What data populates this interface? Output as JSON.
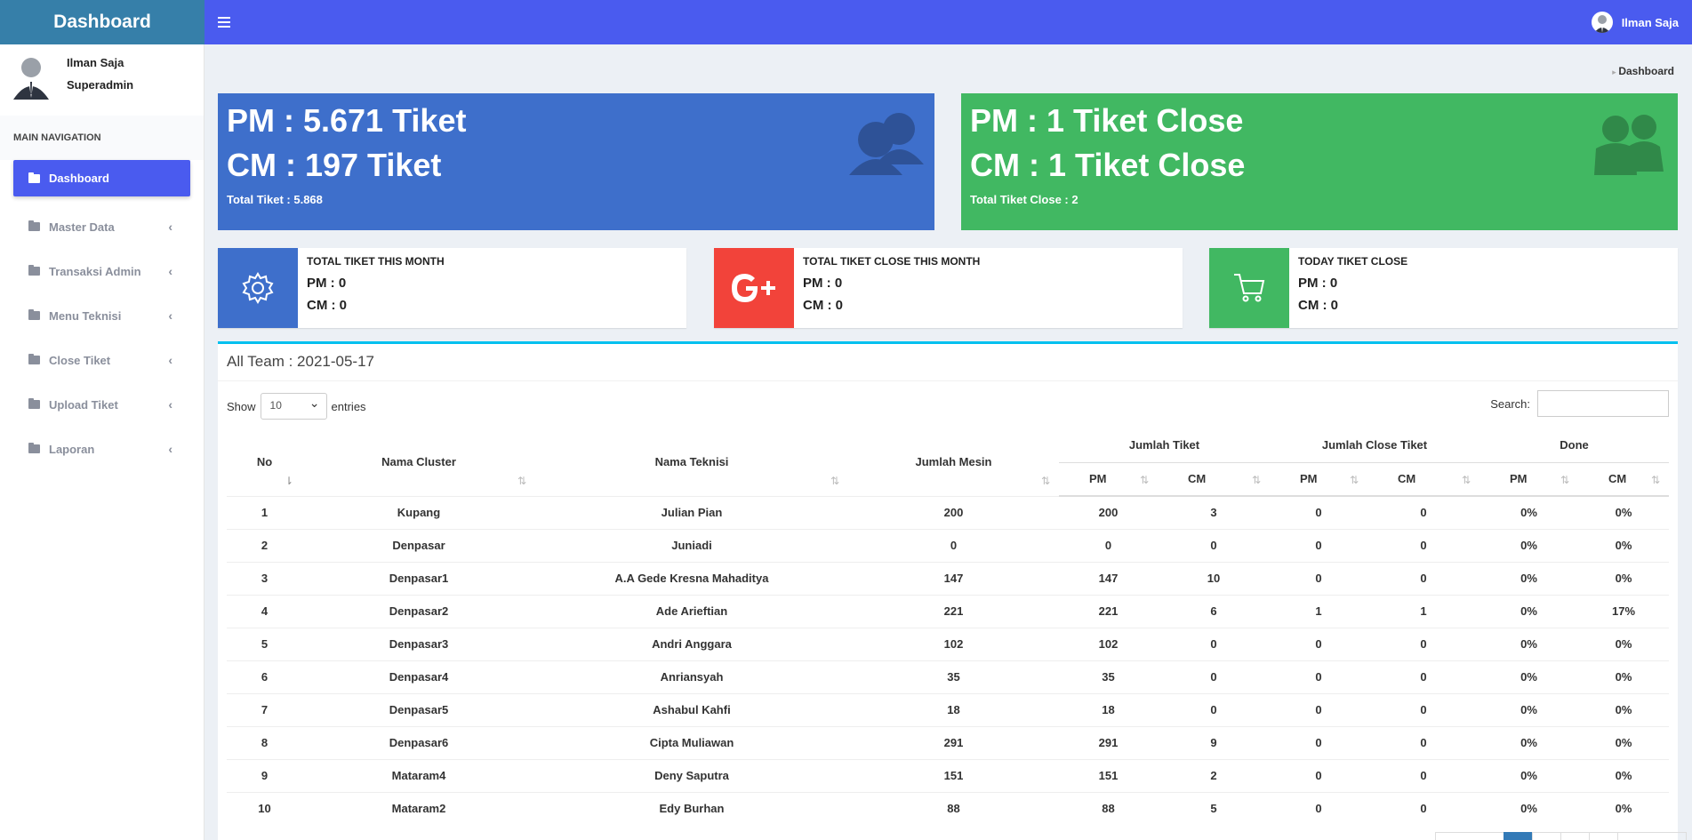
{
  "brand": "Dashboard",
  "topbar": {
    "user_name": "Ilman Saja"
  },
  "sidebar": {
    "user_name": "Ilman Saja",
    "user_role": "Superadmin",
    "nav_header": "MAIN NAVIGATION",
    "items": [
      {
        "label": "Dashboard"
      },
      {
        "label": "Master Data"
      },
      {
        "label": "Transaksi Admin"
      },
      {
        "label": "Menu Teknisi"
      },
      {
        "label": "Close Tiket"
      },
      {
        "label": "Upload Tiket"
      },
      {
        "label": "Laporan"
      }
    ]
  },
  "breadcrumb": "Dashboard",
  "summary": {
    "open": {
      "pm": "PM : 5.671 Tiket",
      "cm": "CM : 197 Tiket",
      "total": "Total Tiket : 5.868",
      "color": "#3e6fcb"
    },
    "close": {
      "pm": "PM : 1 Tiket Close",
      "cm": "CM : 1 Tiket Close",
      "total": "Total Tiket Close : 2",
      "color": "#41b862"
    }
  },
  "infoboxes": [
    {
      "title": "TOTAL TIKET THIS MONTH",
      "pm": "PM : 0",
      "cm": "CM : 0",
      "icon": "gear-icon",
      "color": "#3e6fcb"
    },
    {
      "title": "TOTAL TIKET CLOSE THIS MONTH",
      "pm": "PM : 0",
      "cm": "CM : 0",
      "icon": "google-plus-icon",
      "color": "#f2433a"
    },
    {
      "title": "TODAY TIKET CLOSE",
      "pm": "PM : 0",
      "cm": "CM : 0",
      "icon": "cart-icon",
      "color": "#41b862"
    }
  ],
  "table_box": {
    "title": "All Team : 2021-05-17",
    "show_label": "Show",
    "entries_value": "10",
    "entries_label": "entries",
    "search_label": "Search:",
    "headers": {
      "no": "No",
      "cluster": "Nama Cluster",
      "teknisi": "Nama Teknisi",
      "mesin": "Jumlah Mesin",
      "jumlah_tiket": "Jumlah Tiket",
      "jumlah_close": "Jumlah Close Tiket",
      "done": "Done",
      "pm": "PM",
      "cm": "CM"
    },
    "rows": [
      [
        "1",
        "Kupang",
        "Julian Pian",
        "200",
        "200",
        "3",
        "0",
        "0",
        "0%",
        "0%"
      ],
      [
        "2",
        "Denpasar",
        "Juniadi",
        "0",
        "0",
        "0",
        "0",
        "0",
        "0%",
        "0%"
      ],
      [
        "3",
        "Denpasar1",
        "A.A Gede Kresna Mahaditya",
        "147",
        "147",
        "10",
        "0",
        "0",
        "0%",
        "0%"
      ],
      [
        "4",
        "Denpasar2",
        "Ade Arieftian",
        "221",
        "221",
        "6",
        "1",
        "1",
        "0%",
        "17%"
      ],
      [
        "5",
        "Denpasar3",
        "Andri Anggara",
        "102",
        "102",
        "0",
        "0",
        "0",
        "0%",
        "0%"
      ],
      [
        "6",
        "Denpasar4",
        "Anriansyah",
        "35",
        "35",
        "0",
        "0",
        "0",
        "0%",
        "0%"
      ],
      [
        "7",
        "Denpasar5",
        "Ashabul Kahfi",
        "18",
        "18",
        "0",
        "0",
        "0",
        "0%",
        "0%"
      ],
      [
        "8",
        "Denpasar6",
        "Cipta Muliawan",
        "291",
        "291",
        "9",
        "0",
        "0",
        "0%",
        "0%"
      ],
      [
        "9",
        "Mataram4",
        "Deny Saputra",
        "151",
        "151",
        "2",
        "0",
        "0",
        "0%",
        "0%"
      ],
      [
        "10",
        "Mataram2",
        "Edy Burhan",
        "88",
        "88",
        "5",
        "0",
        "0",
        "0%",
        "0%"
      ]
    ]
  }
}
